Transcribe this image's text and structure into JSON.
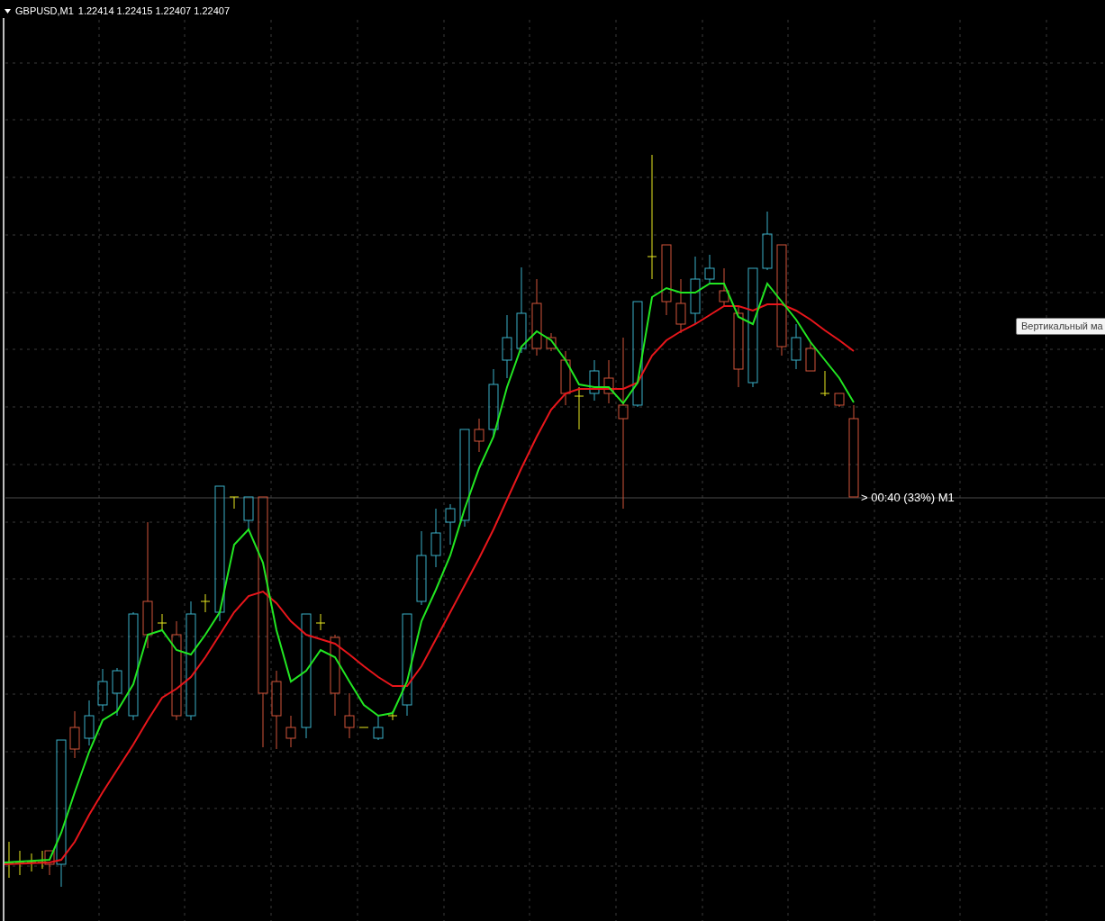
{
  "chart": {
    "symbol": "GBPUSD,M1",
    "ohlc": "1.22414 1.22415 1.22407 1.22407",
    "timer": "> 00:40 (33%) M1"
  },
  "tooltip": {
    "text": "Вертикальный ма"
  }
}
